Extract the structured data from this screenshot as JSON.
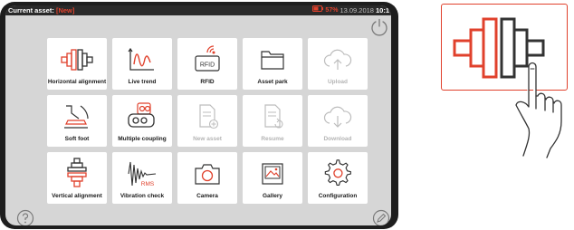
{
  "status": {
    "asset_label": "Current asset:",
    "asset_value": "[New]",
    "battery": "57%",
    "date": "13.09.2018",
    "time": "10:1"
  },
  "tiles": [
    {
      "label": "Horizontal alignment",
      "icon": "horizontal-alignment-icon",
      "enabled": true
    },
    {
      "label": "Live trend",
      "icon": "live-trend-icon",
      "enabled": true
    },
    {
      "label": "RFID",
      "icon": "rfid-icon",
      "enabled": true
    },
    {
      "label": "Asset park",
      "icon": "folder-icon",
      "enabled": true
    },
    {
      "label": "Upload",
      "icon": "cloud-upload-icon",
      "enabled": false
    },
    {
      "label": "Soft foot",
      "icon": "soft-foot-icon",
      "enabled": true
    },
    {
      "label": "Multiple coupling",
      "icon": "multiple-coupling-icon",
      "enabled": true
    },
    {
      "label": "New asset",
      "icon": "new-document-icon",
      "enabled": false
    },
    {
      "label": "Resume",
      "icon": "resume-document-icon",
      "enabled": false
    },
    {
      "label": "Download",
      "icon": "cloud-download-icon",
      "enabled": false
    },
    {
      "label": "Vertical alignment",
      "icon": "vertical-alignment-icon",
      "enabled": true
    },
    {
      "label": "Vibration check",
      "icon": "vibration-check-icon",
      "enabled": true
    },
    {
      "label": "Camera",
      "icon": "camera-icon",
      "enabled": true
    },
    {
      "label": "Gallery",
      "icon": "gallery-icon",
      "enabled": true
    },
    {
      "label": "Configuration",
      "icon": "gear-icon",
      "enabled": true
    }
  ],
  "icon_texts": {
    "rfid": "RFID",
    "rms": "RMS"
  },
  "colors": {
    "accent": "#e0412c",
    "dark": "#333333",
    "disabled": "#b4b4b4",
    "screen_bg": "#d6d6d6"
  }
}
